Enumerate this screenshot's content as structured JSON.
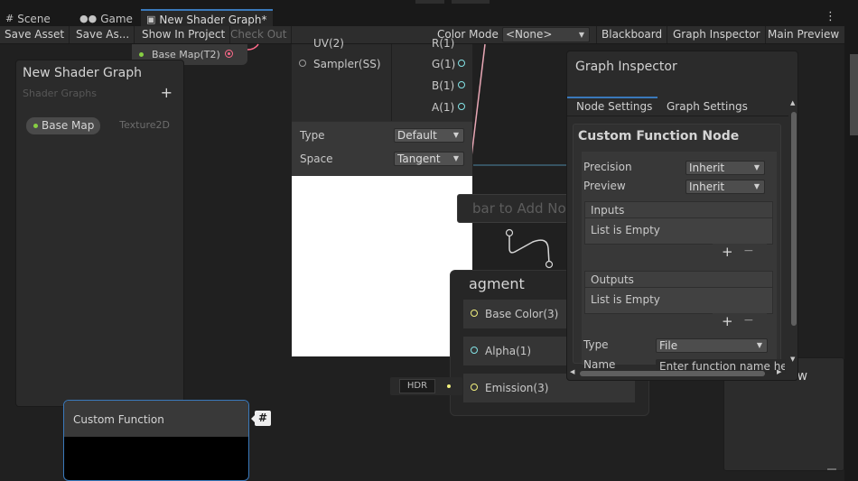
{
  "tabs": {
    "scene": "Scene",
    "game": "Game",
    "shader": "New Shader Graph*"
  },
  "toolbar": {
    "save_asset": "Save Asset",
    "save_as": "Save As...",
    "show_in_project": "Show In Project",
    "check_out": "Check Out",
    "color_mode_label": "Color Mode",
    "color_mode_value": "<None>",
    "blackboard": "Blackboard",
    "graph_inspector": "Graph Inspector",
    "main_preview": "Main Preview"
  },
  "blackboard": {
    "title": "New Shader Graph",
    "subtitle": "Shader Graphs",
    "property_name": "Base Map",
    "property_type": "Texture2D"
  },
  "basemap_node": {
    "label": "Base Map(T2)"
  },
  "sampler_node": {
    "inputs": [
      "UV(2)",
      "Sampler(SS)"
    ],
    "outputs": [
      "R(1)",
      "G(1)",
      "B(1)",
      "A(1)"
    ],
    "type_label": "Type",
    "type_value": "Default",
    "space_label": "Space",
    "space_value": "Tangent"
  },
  "search_fragment": "bar to Add Node",
  "fragment": {
    "title": "agment",
    "slots": [
      "Base Color(3)",
      "Alpha(1)",
      "Emission(3)"
    ],
    "hdr": "HDR"
  },
  "main_preview": {
    "title_fragment": "ew"
  },
  "inspector": {
    "title": "Graph Inspector",
    "tab_node": "Node Settings",
    "tab_graph": "Graph Settings",
    "section_title": "Custom Function Node",
    "precision_label": "Precision",
    "precision_value": "Inherit",
    "preview_label": "Preview",
    "preview_value": "Inherit",
    "inputs_title": "Inputs",
    "inputs_empty": "List is Empty",
    "outputs_title": "Outputs",
    "outputs_empty": "List is Empty",
    "type_label": "Type",
    "type_value": "File",
    "name_label": "Name",
    "name_placeholder": "Enter function name here"
  },
  "custom_function_node": {
    "title": "Custom Function"
  },
  "badge": "#",
  "colors": {
    "accent": "#3a79bb",
    "port_cyan": "#84e4e7",
    "port_yellow": "#f2f07e",
    "property_green": "#87cf43",
    "texture_port_pink": "#ff6b8b"
  }
}
